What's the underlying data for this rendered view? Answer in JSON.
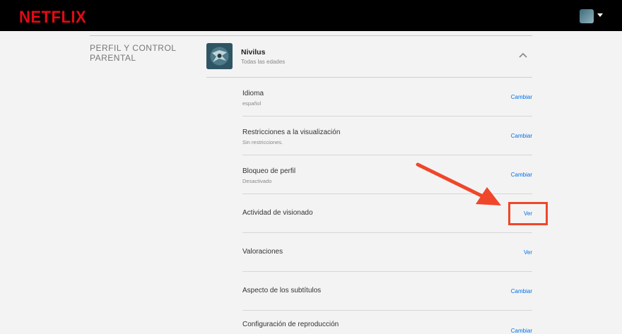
{
  "header": {
    "logo_text": "NETFLIX"
  },
  "section": {
    "title": "PERFIL Y CONTROL PARENTAL"
  },
  "profile": {
    "name": "Nivilus",
    "subtitle": "Todas las edades"
  },
  "rows": [
    {
      "title": "Idioma",
      "value": "español",
      "action": "Cambiar"
    },
    {
      "title": "Restricciones a la visualización",
      "value": "Sin restricciones.",
      "action": "Cambiar"
    },
    {
      "title": "Bloqueo de perfil",
      "value": "Desactivado",
      "action": "Cambiar"
    },
    {
      "title": "Actividad de visionado",
      "value": "",
      "action": "Ver"
    },
    {
      "title": "Valoraciones",
      "value": "",
      "action": "Ver"
    },
    {
      "title": "Aspecto de los subtítulos",
      "value": "",
      "action": "Cambiar"
    },
    {
      "title": "Configuración de reproducción",
      "value": "",
      "action": "Cambiar"
    }
  ],
  "colors": {
    "brand": "#e50914",
    "link": "#0071eb",
    "annotation": "#f0462a",
    "topbar": "#000000",
    "background": "#f3f3f3"
  },
  "icons": {
    "header_avatar": "profile-avatar-icon",
    "header_menu": "caret-down-icon",
    "collapse": "chevron-up-icon",
    "annotation": "red-arrow-icon"
  }
}
